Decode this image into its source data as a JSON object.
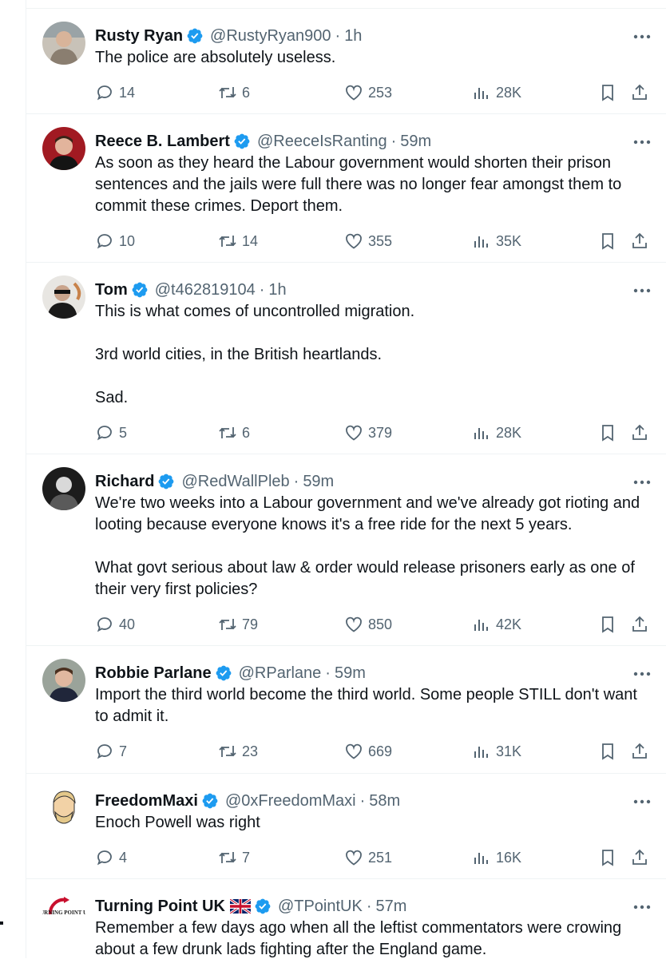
{
  "colors": {
    "text": "#0f1419",
    "secondary": "#536471",
    "verified": "#1d9bf0",
    "divider": "#eff3f4"
  },
  "icons": {
    "reply": "reply-icon",
    "retweet": "retweet-icon",
    "like": "heart-icon",
    "views": "views-icon",
    "bookmark": "bookmark-icon",
    "share": "share-icon",
    "more": "more-icon",
    "verified": "verified-badge-icon"
  },
  "tweets": [
    {
      "name": "Rusty Ryan",
      "handle": "@RustyRyan900",
      "sep": "·",
      "time": "1h",
      "paragraphs": [
        "The police are absolutely useless."
      ],
      "replies": "14",
      "retweets": "6",
      "likes": "253",
      "views": "28K"
    },
    {
      "name": "Reece B. Lambert",
      "handle": "@ReeceIsRanting",
      "sep": "·",
      "time": "59m",
      "paragraphs": [
        "As soon as they heard the Labour government would shorten their prison sentences and the jails were full there was no longer fear amongst them to commit these crimes. Deport them."
      ],
      "replies": "10",
      "retweets": "14",
      "likes": "355",
      "views": "35K"
    },
    {
      "name": "Tom",
      "handle": "@t462819104",
      "sep": "·",
      "time": "1h",
      "paragraphs": [
        "This is what comes of uncontrolled migration.",
        "3rd world cities, in the British heartlands.",
        "Sad."
      ],
      "replies": "5",
      "retweets": "6",
      "likes": "379",
      "views": "28K"
    },
    {
      "name": "Richard",
      "handle": "@RedWallPleb",
      "sep": "·",
      "time": "59m",
      "paragraphs": [
        "We're two weeks into a Labour government and we've already got rioting and looting because everyone knows it's a free ride for the next 5 years.",
        "What govt serious about law & order would release prisoners early as one of their very first policies?"
      ],
      "replies": "40",
      "retweets": "79",
      "likes": "850",
      "views": "42K"
    },
    {
      "name": "Robbie Parlane",
      "handle": "@RParlane",
      "sep": "·",
      "time": "59m",
      "paragraphs": [
        "Import the third world become the third world. Some people STILL don't want to admit it."
      ],
      "replies": "7",
      "retweets": "23",
      "likes": "669",
      "views": "31K"
    },
    {
      "name": "FreedomMaxi",
      "handle": "@0xFreedomMaxi",
      "sep": "·",
      "time": "58m",
      "paragraphs": [
        "Enoch Powell was right"
      ],
      "replies": "4",
      "retweets": "7",
      "likes": "251",
      "views": "16K"
    },
    {
      "name": "Turning Point UK",
      "handle": "@TPointUK",
      "sep": "·",
      "time": "57m",
      "paragraphs": [
        "Remember a few days ago when all the leftist commentators were crowing about a few drunk lads fighting after the England game."
      ],
      "avatar_text": "TURNING POINT UK"
    }
  ]
}
